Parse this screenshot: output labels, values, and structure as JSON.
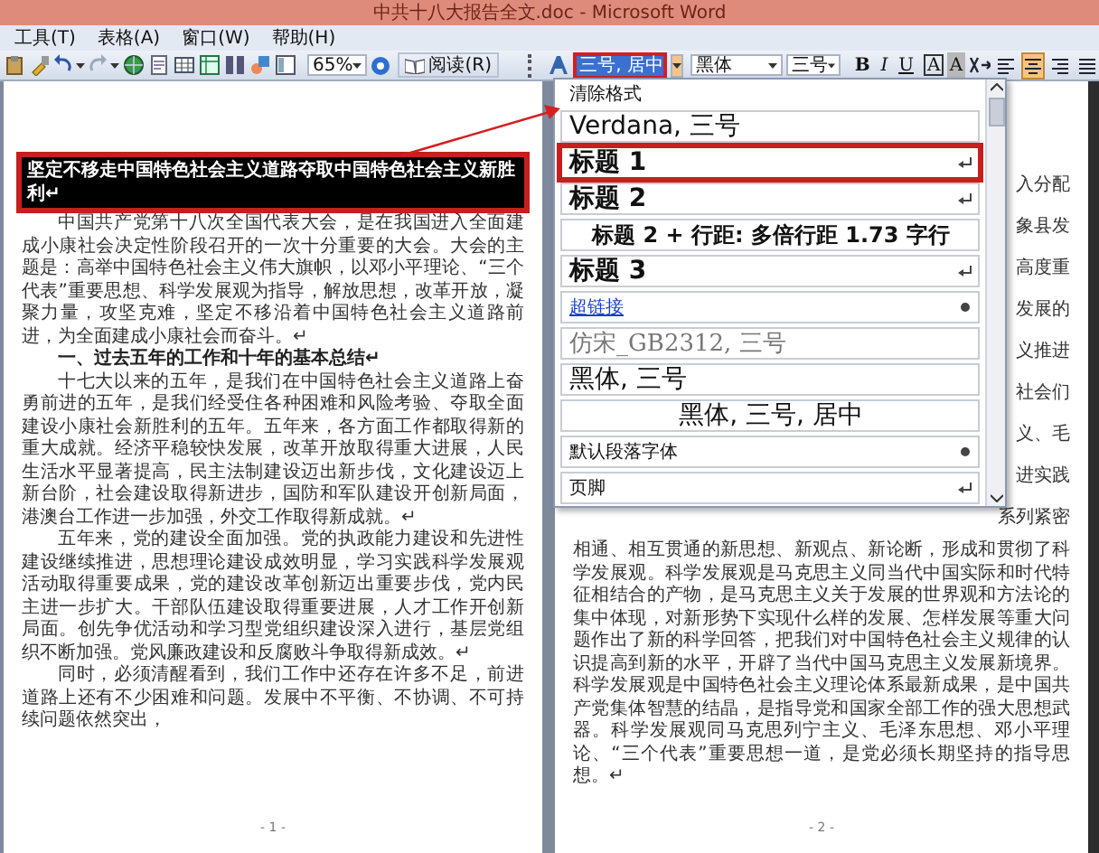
{
  "window": {
    "title": "中共十八大报告全文.doc - Microsoft Word"
  },
  "menu": [
    "工具(T)",
    "表格(A)",
    "窗口(W)",
    "帮助(H)"
  ],
  "toolbar": {
    "zoom": "65%",
    "read_button": "阅读(R)",
    "style_box": {
      "value": "三号, 居中",
      "selected": true,
      "annotated": true
    },
    "font": "黑体",
    "size": "三号",
    "format_buttons": [
      {
        "label": "B",
        "kind": "bold"
      },
      {
        "label": "I",
        "kind": "italic"
      },
      {
        "label": "U",
        "kind": "underline"
      },
      {
        "label": "A",
        "kind": "border"
      },
      {
        "label": "A",
        "kind": "shading"
      }
    ],
    "align_buttons": [
      {
        "kind": "left",
        "on": false
      },
      {
        "kind": "center",
        "on": true
      },
      {
        "kind": "right",
        "on": false
      },
      {
        "kind": "justify",
        "on": false
      }
    ]
  },
  "left_page": {
    "paragraphs": [
      {
        "kind": "title",
        "text": "坚定不移走中国特色社会主义道路夺取中国特色社会主义新胜利↵",
        "selected": true,
        "annotated": true
      },
      {
        "kind": "body",
        "text": "中国共产党第十八次全国代表大会，是在我国进入全面建成小康社会决定性阶段召开的一次十分重要的大会。大会的主题是：高举中国特色社会主义伟大旗帜，以邓小平理论、“三个代表”重要思想、科学发展观为指导，解放思想，改革开放，凝聚力量，攻坚克难，坚定不移沿着中国特色社会主义道路前进，为全面建成小康社会而奋斗。↵"
      },
      {
        "kind": "section",
        "text": "一、过去五年的工作和十年的基本总结↵"
      },
      {
        "kind": "body",
        "text": "十七大以来的五年，是我们在中国特色社会主义道路上奋勇前进的五年，是我们经受住各种困难和风险考验、夺取全面建设小康社会新胜利的五年。五年来，各方面工作都取得新的重大成就。经济平稳较快发展，改革开放取得重大进展，人民生活水平显著提高，民主法制建设迈出新步伐，文化建设迈上新台阶，社会建设取得新进步，国防和军队建设开创新局面，港澳台工作进一步加强，外交工作取得新成就。↵"
      },
      {
        "kind": "body",
        "text": "五年来，党的建设全面加强。党的执政能力建设和先进性建设继续推进，思想理论建设成效明显，学习实践科学发展观活动取得重要成果，党的建设改革创新迈出重要步伐，党内民主进一步扩大。干部队伍建设取得重要进展，人才工作开创新局面。创先争优活动和学习型党组织建设深入进行，基层党组织不断加强。党风廉政建设和反腐败斗争取得新成效。↵"
      },
      {
        "kind": "body",
        "text": "同时，必须清醒看到，我们工作中还存在许多不足，前进道路上还有不少困难和问题。发展中不平衡、不协调、不可持续问题依然突出，"
      }
    ],
    "page_number": "- 1 -"
  },
  "right_page": {
    "covered_line_ends": [
      "入分配",
      "象县发",
      "高度重",
      "发展的",
      "义推进",
      "社会们",
      "义、毛",
      "进实践",
      "系列紧密"
    ],
    "paragraphs": [
      {
        "kind": "continued",
        "text": "相通、相互贯通的新思想、新观点、新论断，形成和贯彻了科学发展观。科学发展观是马克思主义同当代中国实际和时代特征相结合的产物，是马克思主义关于发展的世界观和方法论的集中体现，对新形势下实现什么样的发展、怎样发展等重大问题作出了新的科学回答，把我们对中国特色社会主义规律的认识提高到新的水平，开辟了当代中国马克思主义发展新境界。科学发展观是中国特色社会主义理论体系最新成果，是中国共产党集体智慧的结晶，是指导党和国家全部工作的强大思想武器。科学发展观同马克思列宁主义、毛泽东思想、邓小平理论、“三个代表”重要思想一道，是党必须长期坚持的指导思想。↵"
      }
    ],
    "page_number": "- 2 -"
  },
  "style_list": {
    "items": [
      {
        "label": "清除格式",
        "kind": "small",
        "paragraph_mark": false,
        "character_mark": false
      },
      {
        "label": "Verdana, 三号",
        "kind": "verdana",
        "paragraph_mark": false,
        "character_mark": false
      },
      {
        "label": "标题 1",
        "kind": "heading",
        "paragraph_mark": true,
        "character_mark": false,
        "annotated": true
      },
      {
        "label": "标题 2",
        "kind": "heading",
        "paragraph_mark": true,
        "character_mark": false
      },
      {
        "label": "标题 2 + 行距: 多倍行距 1.73 字行",
        "kind": "centered-heading",
        "paragraph_mark": false,
        "character_mark": false
      },
      {
        "label": "标题 3",
        "kind": "heading",
        "paragraph_mark": true,
        "character_mark": false
      },
      {
        "label": "超链接",
        "kind": "link",
        "paragraph_mark": false,
        "character_mark": true
      },
      {
        "label": "仿宋_GB2312, 三号",
        "kind": "fangsong",
        "paragraph_mark": false,
        "character_mark": false
      },
      {
        "label": "黑体, 三号",
        "kind": "heiti",
        "paragraph_mark": false,
        "character_mark": false
      },
      {
        "label": "黑体, 三号, 居中",
        "kind": "centered",
        "paragraph_mark": false,
        "character_mark": false
      },
      {
        "label": "默认段落字体",
        "kind": "small",
        "paragraph_mark": false,
        "character_mark": true
      },
      {
        "label": "页脚",
        "kind": "small",
        "paragraph_mark": true,
        "character_mark": false
      }
    ]
  }
}
